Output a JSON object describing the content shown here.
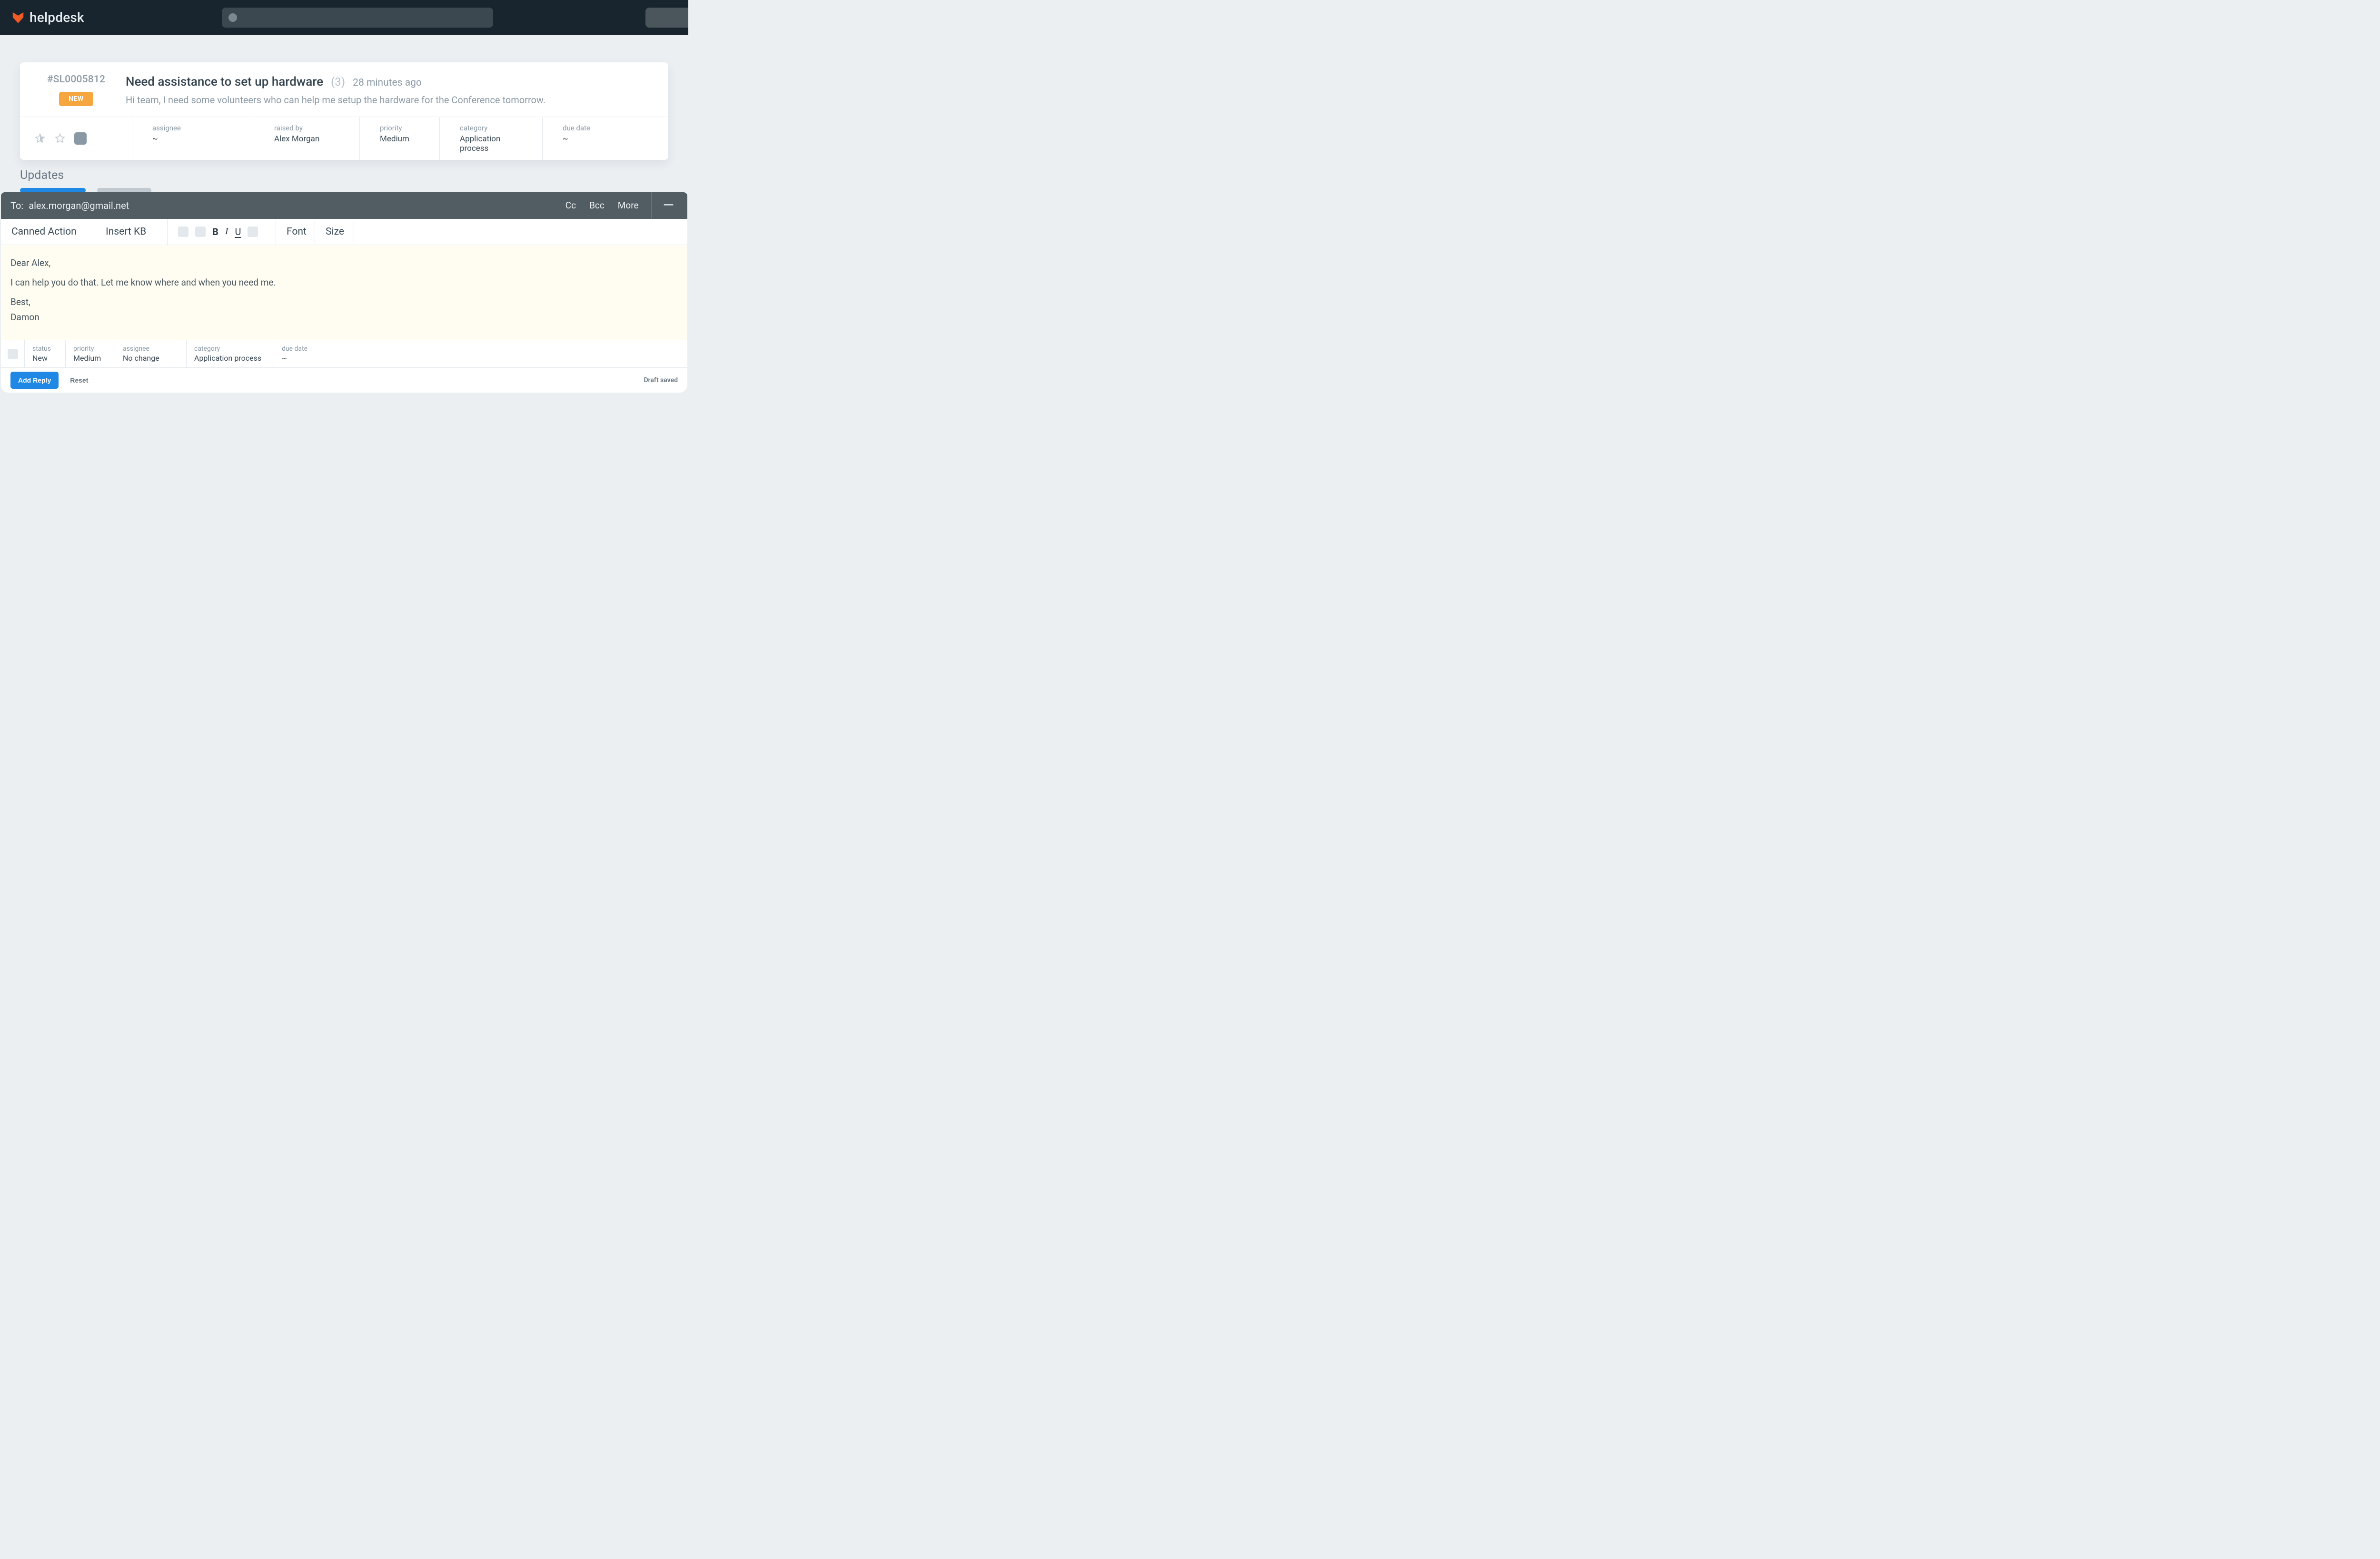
{
  "brand": {
    "name": "helpdesk"
  },
  "ticket": {
    "id": "#SL0005812",
    "badge": "NEW",
    "title": "Need assistance to set up hardware",
    "count": "(3)",
    "time": "28 minutes ago",
    "description": "Hi team, I need some volunteers who can help me setup the hardware for the Conference tomorrow.",
    "meta": {
      "assignee": {
        "label": "assignee",
        "value": "~"
      },
      "raised_by": {
        "label": "raised by",
        "value": "Alex Morgan"
      },
      "priority": {
        "label": "priority",
        "value": "Medium"
      },
      "category": {
        "label": "category",
        "value": "Application process"
      },
      "due_date": {
        "label": "due date",
        "value": "~"
      }
    }
  },
  "updates": {
    "title": "Updates"
  },
  "compose": {
    "to_label": "To:",
    "to_value": "alex.morgan@gmail.net",
    "cc": "Cc",
    "bcc": "Bcc",
    "more": "More",
    "toolbar": {
      "canned_action": "Canned Action",
      "insert_kb": "Insert KB",
      "bold": "B",
      "italic": "I",
      "underline": "U",
      "font": "Font",
      "size": "Size"
    },
    "body": {
      "greeting": "Dear Alex,",
      "line1": "I can help you do that. Let me know where and when you need me.",
      "closing": "Best,",
      "signature": "Damon"
    },
    "reply_meta": {
      "status": {
        "label": "status",
        "value": "New"
      },
      "priority": {
        "label": "priority",
        "value": "Medium"
      },
      "assignee": {
        "label": "assignee",
        "value": "No change"
      },
      "category": {
        "label": "category",
        "value": "Application process"
      },
      "due_date": {
        "label": "due date",
        "value": "~"
      }
    },
    "footer": {
      "add_reply": "Add Reply",
      "reset": "Reset",
      "draft_saved": "Draft saved"
    }
  }
}
